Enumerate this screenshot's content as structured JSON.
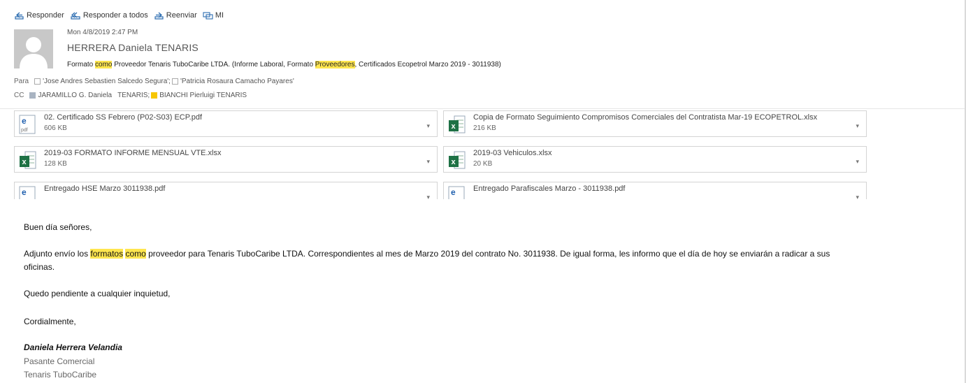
{
  "actions": {
    "reply": "Responder",
    "reply_all": "Responder a todos",
    "forward": "Reenviar",
    "im": "MI"
  },
  "message": {
    "date": "Mon 4/8/2019 2:47 PM",
    "sender": "HERRERA Daniela TENARIS",
    "subject": {
      "p1": "Formato ",
      "h1": "como",
      "p2": " Proveedor Tenaris TuboCaribe LTDA. (Informe Laboral, Formato ",
      "h2": "Proveedores",
      "p3": ", Certificados Ecopetrol Marzo 2019 - 3011938)"
    }
  },
  "recipients": {
    "to_label": "Para",
    "to": [
      "'Jose Andres Sebastien Salcedo Segura';",
      "'Patricia Rosaura Camacho Payares'"
    ],
    "cc_label": "CC",
    "cc": [
      "JARAMILLO G. Daniela",
      "TENARIS;",
      "BIANCHI Pierluigi TENARIS"
    ]
  },
  "attachments": [
    {
      "name": "02. Certificado SS Febrero (P02-S03) ECP.pdf",
      "size": "606 KB",
      "icon": "pdf-file-icon",
      "icon_text": "pdf"
    },
    {
      "name": "Copia de Formato Seguimiento Compromisos Comerciales del Contratista Mar-19 ECOPETROL.xlsx",
      "size": "216 KB",
      "icon": "excel-file-icon",
      "icon_text": "x"
    },
    {
      "name": "2019-03 FORMATO INFORME MENSUAL VTE.xlsx",
      "size": "128 KB",
      "icon": "excel-file-icon",
      "icon_text": "x"
    },
    {
      "name": "2019-03 Vehiculos.xlsx",
      "size": "20 KB",
      "icon": "excel-file-icon",
      "icon_text": "x"
    },
    {
      "name": "Entregado HSE Marzo 3011938.pdf",
      "size": "",
      "icon": "pdf-file-icon",
      "icon_text": "pdf"
    },
    {
      "name": "Entregado Parafiscales Marzo - 3011938.pdf",
      "size": "",
      "icon": "pdf-file-icon",
      "icon_text": "pdf"
    }
  ],
  "body": {
    "greeting": "Buen día señores,",
    "para": {
      "p1": "Adjunto envío los ",
      "h1": "formatos",
      "p2": " ",
      "h2": "como",
      "p3": " proveedor para Tenaris TuboCaribe LTDA. Correspondientes al mes de Marzo 2019 del contrato No. 3011938. De igual forma, les informo que el día de hoy se enviarán a radicar a sus",
      "p4": "oficinas."
    },
    "pending": "Quedo pendiente a cualquier inquietud,",
    "closing": "Cordialmente,",
    "signature": {
      "name": "Daniela Herrera Velandia",
      "title": "Pasante Comercial",
      "company": "Tenaris TuboCaribe"
    }
  },
  "colors": {
    "highlight": "#ffe64f",
    "excel_green": "#1e7145",
    "pdf_blue": "#1f5fae",
    "cc_yellow": "#f7c600"
  }
}
